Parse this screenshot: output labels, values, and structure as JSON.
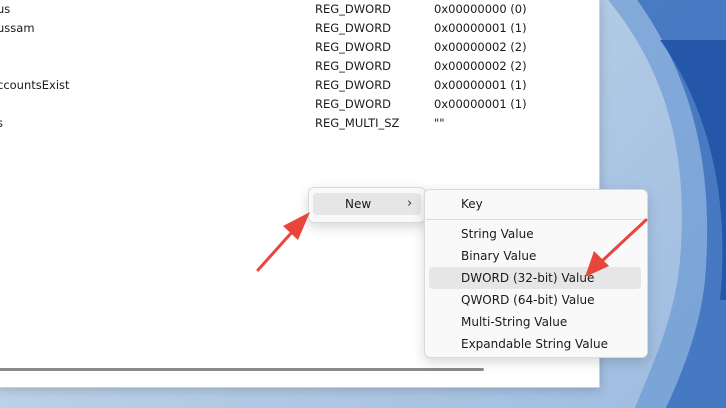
{
  "registry": {
    "rows": [
      {
        "name": "us",
        "type": "REG_DWORD",
        "data": "0x00000000 (0)"
      },
      {
        "name": "ussam",
        "type": "REG_DWORD",
        "data": "0x00000001 (1)"
      },
      {
        "name": "",
        "type": "REG_DWORD",
        "data": "0x00000002 (2)"
      },
      {
        "name": "",
        "type": "REG_DWORD",
        "data": "0x00000002 (2)"
      },
      {
        "name": "ccountsExist",
        "type": "REG_DWORD",
        "data": "0x00000001 (1)"
      },
      {
        "name": "",
        "type": "REG_DWORD",
        "data": "0x00000001 (1)"
      },
      {
        "name": "s",
        "type": "REG_MULTI_SZ",
        "data": "\"\""
      }
    ]
  },
  "context_menu": {
    "new_label": "New",
    "chevron_icon": "chevron-right-icon"
  },
  "submenu": {
    "key": "Key",
    "string_value": "String Value",
    "binary_value": "Binary Value",
    "dword_value": "DWORD (32-bit) Value",
    "qword_value": "QWORD (64-bit) Value",
    "multi_string_value": "Multi-String Value",
    "expandable_string_value": "Expandable String Value"
  },
  "colors": {
    "annotation_arrow": "#e8453c",
    "highlight": "#e6e6e6"
  }
}
